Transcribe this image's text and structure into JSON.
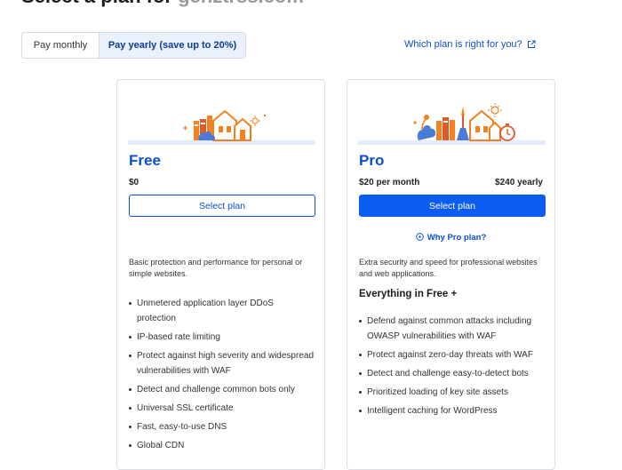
{
  "header": {
    "title_prefix": "Select a plan for",
    "domain": "genztrss.com"
  },
  "billing_toggle": {
    "monthly_label": "Pay monthly",
    "yearly_label": "Pay yearly (save up to 20%)",
    "selected": "yearly"
  },
  "help_link": {
    "label": "Which plan is right for you?"
  },
  "plans": [
    {
      "name": "Free",
      "price": "$0",
      "button_label": "Select plan",
      "description": "Basic protection and performance for personal or simple websites.",
      "features": [
        "Unmetered application layer DDoS protection",
        "IP-based rate limiting",
        "Protect against high severity and widespread vulnerabilities with WAF",
        "Detect and challenge common bots only",
        "Universal SSL certificate",
        "Fast, easy-to-use DNS",
        "Global CDN"
      ]
    },
    {
      "name": "Pro",
      "price": "$20 per month",
      "price_yearly": "$240 yearly",
      "button_label": "Select plan",
      "why_label": "Why Pro plan?",
      "description": "Extra security and speed for professional websites and web applications.",
      "includes_heading": "Everything in Free +",
      "features": [
        "Defend against common attacks including OWASP vulnerabilities with WAF",
        "Protect against zero-day threats with WAF",
        "Detect and challenge easy-to-detect bots",
        "Prioritized loading of key site assets",
        "Intelligent caching for WordPress"
      ]
    }
  ],
  "colors": {
    "accent": "#0a4fd1",
    "button_primary": "#0b5cf0",
    "toggle_selected_bg": "#eaf1fd",
    "illustration_orange": "#f48120",
    "illustration_ground": "#e3ecfb"
  }
}
